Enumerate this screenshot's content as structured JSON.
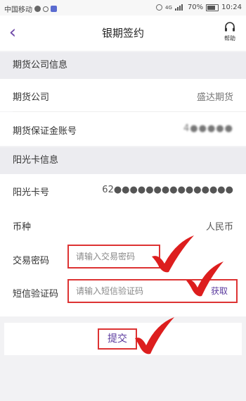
{
  "status_bar": {
    "carrier": "中国移动",
    "signal_tag": "4G",
    "battery": "70%",
    "time": "10:24"
  },
  "header": {
    "title": "银期签约",
    "help_label": "帮助"
  },
  "futures_section": {
    "title": "期货公司信息",
    "company_label": "期货公司",
    "company_value": "盛达期货",
    "margin_account_label": "期货保证金账号",
    "margin_account_value": "4●●●●●"
  },
  "card_section": {
    "title": "阳光卡信息",
    "card_label": "阳光卡号",
    "card_value": "62●●●●●●●●●●●●●●●",
    "currency_label": "币种",
    "currency_value": "人民币",
    "trade_password_label": "交易密码",
    "trade_password_placeholder": "请输入交易密码",
    "sms_label": "短信验证码",
    "sms_placeholder": "请输入短信验证码",
    "get_code_label": "获取"
  },
  "submit": {
    "label": "提交"
  },
  "colors": {
    "accent": "#5a3a9e",
    "annotation_red": "#dd1e1e",
    "section_bg": "#ececf0"
  }
}
